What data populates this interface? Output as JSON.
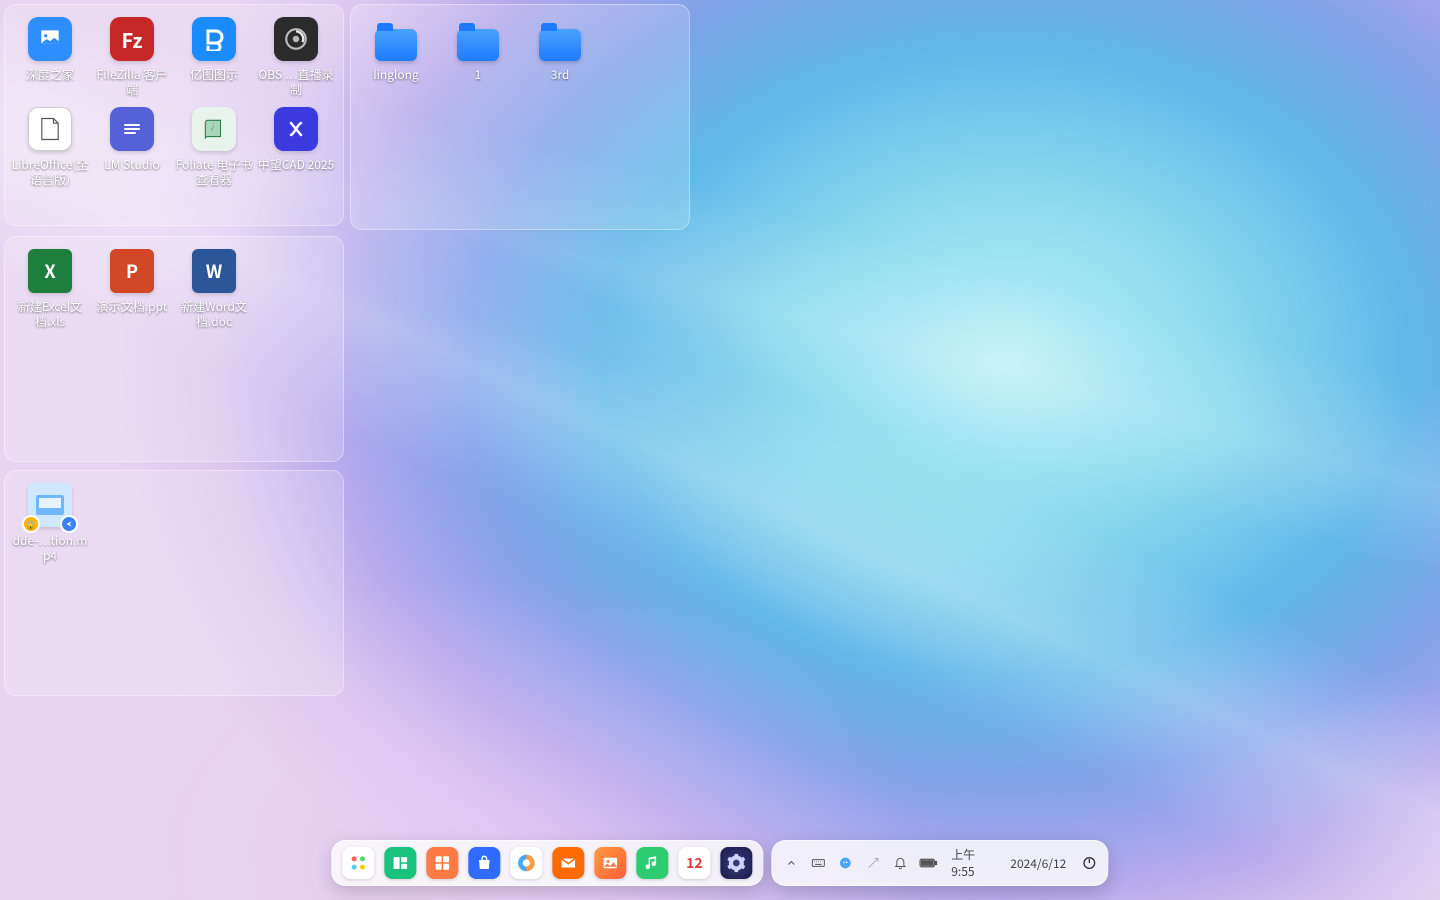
{
  "panels": {
    "apps": {
      "items": [
        {
          "label": "深度之家",
          "icon": "deepin"
        },
        {
          "label": "FileZilla 客户端",
          "icon": "filezilla"
        },
        {
          "label": "亿图图示",
          "icon": "edraw"
        },
        {
          "label": "OBS …直播录制",
          "icon": "obs"
        },
        {
          "label": "LibreOffice(全语言版)",
          "icon": "lo"
        },
        {
          "label": "LM Studio",
          "icon": "lm"
        },
        {
          "label": "Foliate 电子书查看器",
          "icon": "foliate"
        },
        {
          "label": "中望CAD 2025",
          "icon": "zwcad"
        }
      ]
    },
    "folders": {
      "items": [
        {
          "label": "linglong"
        },
        {
          "label": "1"
        },
        {
          "label": "3rd"
        }
      ]
    },
    "docs": {
      "items": [
        {
          "label": "新建Excel文档.xls",
          "icon": "xls",
          "glyph": "X"
        },
        {
          "label": "演示文档.ppt",
          "icon": "ppt",
          "glyph": "P"
        },
        {
          "label": "新建Word文档.doc",
          "icon": "doc",
          "glyph": "W"
        }
      ]
    },
    "media": {
      "items": [
        {
          "label": "dde-…tion.mp4",
          "icon": "video"
        }
      ]
    }
  },
  "dock": {
    "apps": [
      {
        "name": "launcher"
      },
      {
        "name": "multitask"
      },
      {
        "name": "app-grid"
      },
      {
        "name": "app-store"
      },
      {
        "name": "browser"
      },
      {
        "name": "mail"
      },
      {
        "name": "photos"
      },
      {
        "name": "music"
      },
      {
        "name": "calendar",
        "day": "12"
      },
      {
        "name": "control-center"
      }
    ],
    "tray": {
      "time": "上午9:55",
      "date": "2024/6/12"
    }
  }
}
